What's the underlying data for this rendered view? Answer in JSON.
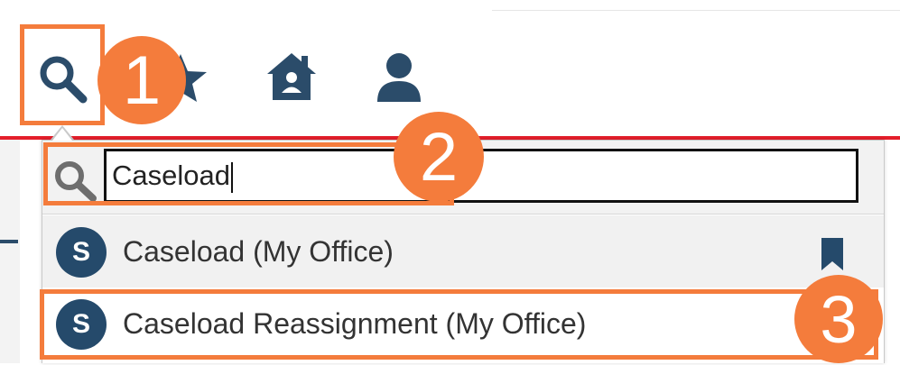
{
  "toolbar": {
    "icons": [
      "search-icon",
      "star-icon",
      "home-icon",
      "user-icon"
    ],
    "icon_color": "#2b4c6a"
  },
  "search": {
    "value": "Caseload",
    "icon": "search-icon",
    "icon_color": "#6e6e6e"
  },
  "results": [
    {
      "badge": "S",
      "label": "Caseload (My Office)",
      "bookmarked": true
    },
    {
      "badge": "S",
      "label": "Caseload Reassignment (My Office)",
      "bookmarked": false
    }
  ],
  "callouts": [
    "1",
    "2",
    "3"
  ],
  "colors": {
    "accent": "#f47c3c",
    "badge": "#254a6b",
    "red_line": "#e41f2b"
  }
}
